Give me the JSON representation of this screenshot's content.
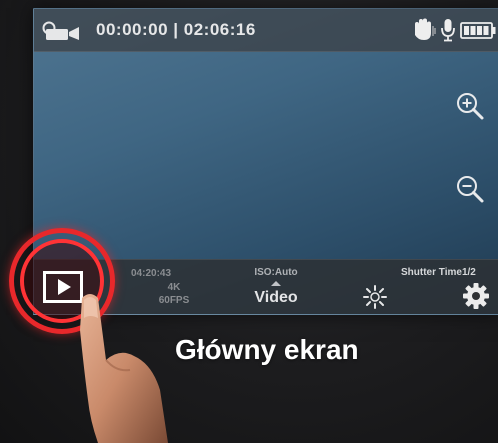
{
  "topbar": {
    "camera_icon": "video-camera-icon",
    "timecode": "00:00:00 | 02:06:16",
    "hand_icon": "hand-gesture-icon",
    "mic_icon": "microphone-icon",
    "battery_icon": "battery-icon",
    "battery_level": 1.0
  },
  "viewfinder": {
    "zoom_in_icon": "zoom-in-icon",
    "zoom_out_icon": "zoom-out-icon"
  },
  "bottombar": {
    "remaining_time": "04:20:43",
    "resolution": "4K",
    "framerate": "60FPS",
    "iso": "ISO:Auto",
    "mode": "Video",
    "white_balance_icon": "white-balance-icon",
    "shutter": "Shutter Time1/2",
    "settings_icon": "gear-icon"
  },
  "playback": {
    "icon": "play-icon"
  },
  "caption": "Główny ekran",
  "colors": {
    "highlight_ring": "#e8282b",
    "screen_blue": "#3f6683"
  }
}
